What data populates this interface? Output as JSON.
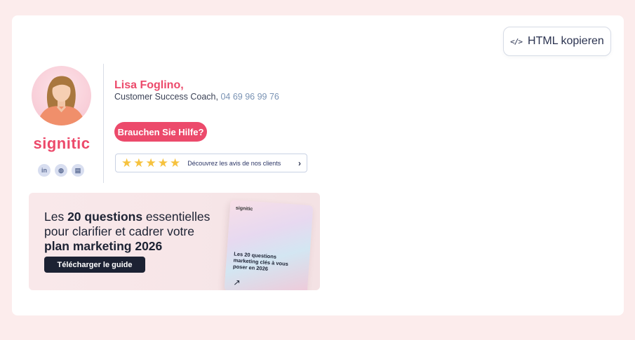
{
  "toolbar": {
    "copy_icon": "</>",
    "copy_label": "HTML kopieren"
  },
  "signature": {
    "name": "Lisa Foglino,",
    "role": "Customer Success Coach, ",
    "phone": "04 69 96 99 76",
    "logo_text": "signitic",
    "help_button": "Brauchen Sie Hilfe?",
    "social": [
      {
        "icon": "linkedin-icon",
        "glyph": "in"
      },
      {
        "icon": "globe-icon",
        "glyph": "◍"
      },
      {
        "icon": "contact-card-icon",
        "glyph": "▤"
      }
    ],
    "reviews": {
      "stars": 5,
      "text": "Découvrez les avis de nos clients"
    }
  },
  "banner": {
    "line1_pre": "Les ",
    "line1_bold": "20 questions",
    "line1_post": " essentielles",
    "line2": "pour clarifier et cadrer votre",
    "line3": "plan marketing 2026",
    "button": "Télécharger le guide",
    "book_logo": "signitic",
    "book_text": "Les 20 questions marketing clés à vous poser en 2026"
  },
  "colors": {
    "page_bg": "#fcecec",
    "accent": "#ec4a6b",
    "dark": "#1c2233",
    "star": "#f6c23e"
  }
}
